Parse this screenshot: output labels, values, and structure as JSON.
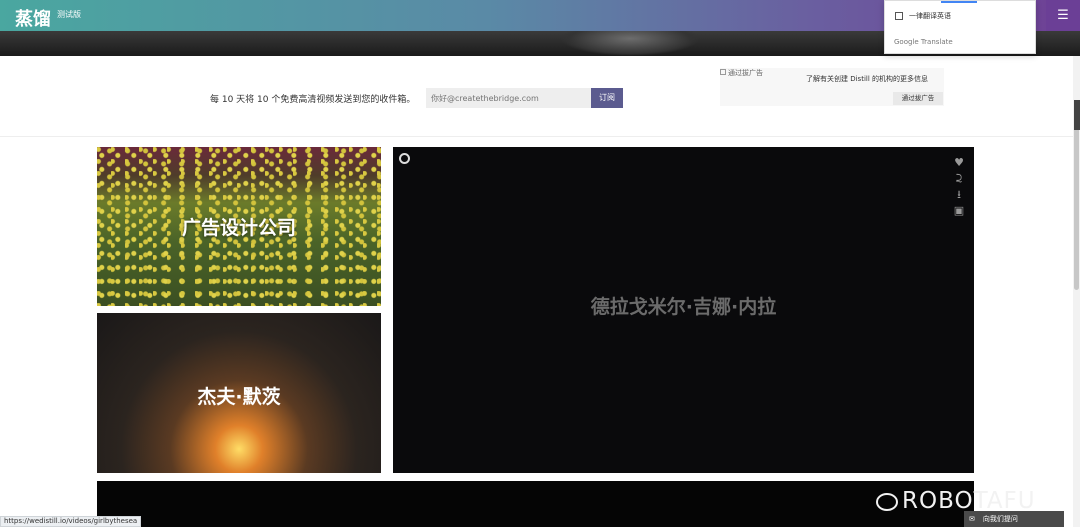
{
  "header": {
    "logo": "蒸馏",
    "beta": "测试版",
    "menu_icon": "hamburger-icon"
  },
  "translate_popup": {
    "option": "一律翻译英语",
    "brand": "Google Translate"
  },
  "subscribe": {
    "text": "每 10 天将 10 个免费高清视频发送到您的收件箱。",
    "email_placeholder": "你好@createthebridge.com",
    "button": "订阅"
  },
  "ad": {
    "img_alt": "通过拔广告",
    "info": "了解有关创建 Distill 的机构的更多信息",
    "button": "通过拔广告"
  },
  "tiles": {
    "tulips_title": "广告设计公司",
    "glass_title": "杰夫·默茨",
    "video_title": "德拉戈米尔·吉娜·内拉"
  },
  "video_icons": [
    "heart-icon",
    "share-icon",
    "download-icon",
    "camera-icon"
  ],
  "status_url": "https://wedistill.io/videos/girlbythesea",
  "watermark": "ROBOTAFU",
  "feedback": "向我们提问"
}
